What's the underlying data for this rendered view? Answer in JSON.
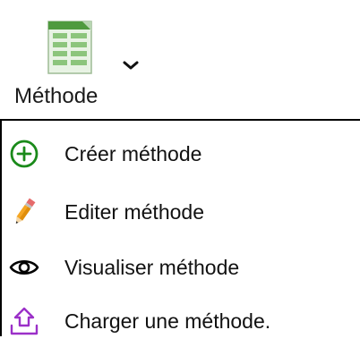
{
  "ribbon": {
    "button_label": "Méthode",
    "icon": "spreadsheet-icon",
    "dropdown_icon": "chevron-down-icon"
  },
  "menu": {
    "items": [
      {
        "label": "Créer méthode",
        "icon": "add-circle-icon",
        "color": "#1a8a1a"
      },
      {
        "label": "Editer méthode",
        "icon": "pencil-icon",
        "color": "#f0a21c"
      },
      {
        "label": "Visualiser méthode",
        "icon": "eye-icon",
        "color": "#000000"
      },
      {
        "label": "Charger une méthode.",
        "icon": "upload-icon",
        "color": "#9b30c8"
      }
    ]
  }
}
